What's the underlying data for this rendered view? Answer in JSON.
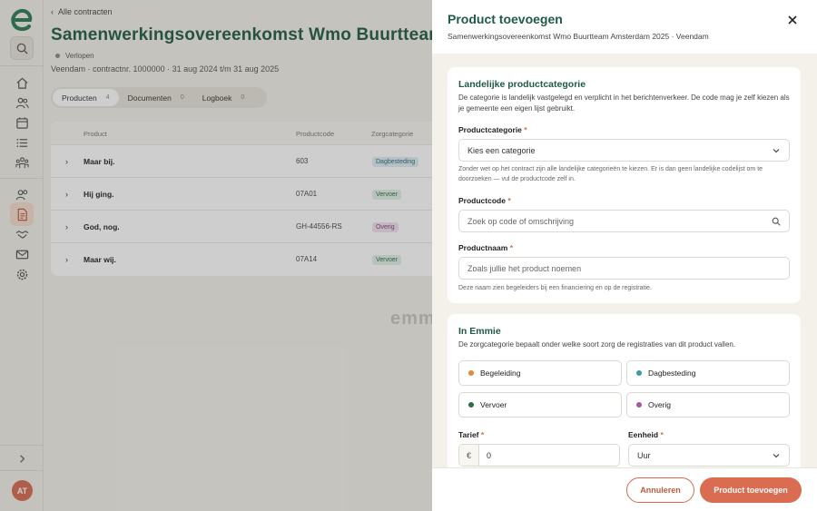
{
  "sidebar": {
    "logo_letter": "e",
    "avatar_initials": "AT",
    "icons": [
      "search-icon",
      "home-icon",
      "users-icon",
      "calendar-icon",
      "list-icon",
      "people-icon",
      "team-icon",
      "contract-icon",
      "handshake-icon",
      "mail-icon",
      "gear-icon",
      "expand-icon"
    ]
  },
  "main": {
    "back_label": "Alle contracten",
    "title": "Samenwerkingsovereenkomst Wmo Buurtteam Am",
    "status": "Verlopen",
    "meta": "Veendam · contractnr. 1000000 · 31 aug 2024 t/m 31 aug 2025",
    "tabs": [
      {
        "label": "Producten",
        "count": "4"
      },
      {
        "label": "Documenten",
        "count": "0"
      },
      {
        "label": "Logboek",
        "count": "0"
      }
    ],
    "table": {
      "headers": [
        "Product",
        "Productcode",
        "Zorgcategorie"
      ],
      "rows": [
        {
          "name": "Maar bij.",
          "code": "603",
          "category": "Dagbesteding"
        },
        {
          "name": "Hij ging.",
          "code": "07A01",
          "category": "Vervoer"
        },
        {
          "name": "God, nog.",
          "code": "GH-44556-RS",
          "category": "Overig"
        },
        {
          "name": "Maar wij.",
          "code": "07A14",
          "category": "Vervoer"
        }
      ]
    },
    "watermark": "emm"
  },
  "panel": {
    "title": "Product toevoegen",
    "subtitle": "Samenwerkingsovereenkomst Wmo Buurtteam Amsterdam 2025 · Veendam",
    "card1": {
      "title": "Landelijke productcategorie",
      "desc": "De categorie is landelijk vastgelegd en verplicht in het berichtenverkeer. De code mag je zelf kiezen als je gemeente een eigen lijst gebruikt.",
      "category_label": "Productcategorie",
      "category_value": "Kies een categorie",
      "category_help": "Zonder wet op het contract zijn alle landelijke categorieën te kiezen. Er is dan geen landelijke codelijst om te doorzoeken — vul de productcode zelf in.",
      "code_label": "Productcode",
      "code_placeholder": "Zoek op code of omschrijving",
      "name_label": "Productnaam",
      "name_placeholder": "Zoals jullie het product noemen",
      "name_help": "Deze naam zien begeleiders bij een financiering en op de registratie."
    },
    "card2": {
      "title": "In Emmie",
      "desc": "De zorgcategorie bepaalt onder welke soort zorg de registraties van dit product vallen.",
      "options": [
        {
          "label": "Begeleiding",
          "color": "#e08a3c"
        },
        {
          "label": "Dagbesteding",
          "color": "#3a9aa8"
        },
        {
          "label": "Vervoer",
          "color": "#2c6a48"
        },
        {
          "label": "Overig",
          "color": "#a9579f"
        }
      ],
      "tarief_label": "Tarief",
      "currency": "€",
      "tarief_value": "0",
      "eenheid_label": "Eenheid",
      "eenheid_value": "Uur"
    },
    "required_marker": "*",
    "cancel_label": "Annuleren",
    "submit_label": "Product toevoegen"
  },
  "colors": {
    "brand_green": "#1f5a44",
    "accent_orange": "#d96c51"
  }
}
